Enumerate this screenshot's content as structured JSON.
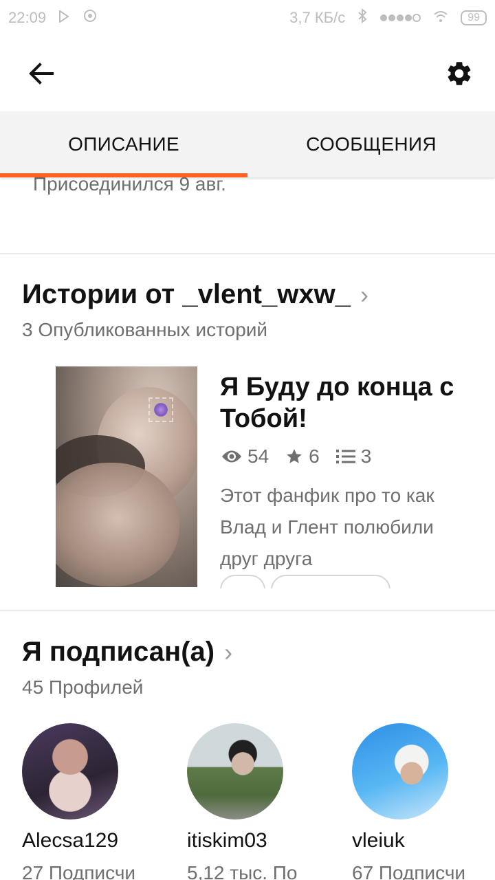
{
  "status_bar": {
    "time": "22:09",
    "network_speed": "3,7 КБ/с",
    "battery": "99"
  },
  "app_bar": {
    "back_icon": "arrow-left-icon",
    "settings_icon": "gear-icon"
  },
  "tabs": [
    {
      "label": "ОПИСАНИЕ",
      "active": true
    },
    {
      "label": "СООБЩЕНИЯ",
      "active": false
    }
  ],
  "about": {
    "joined": "Присоединился 9 авг."
  },
  "stories": {
    "title": "Истории от _vlent_wxw_",
    "subtitle": "3 Опубликованных историй",
    "items": [
      {
        "title": "Я Буду до конца с Тобой!",
        "views": "54",
        "votes": "6",
        "parts": "3",
        "description": "Этот фанфик про то как Влад и Глент полюбили друг друга"
      }
    ]
  },
  "following": {
    "title": "Я подписан(а)",
    "subtitle": "45 Профилей",
    "profiles": [
      {
        "name": "Alecsa129",
        "followers": "27 Подписчи"
      },
      {
        "name": "itiskim03",
        "followers": "5,12 тыс. По"
      },
      {
        "name": "vleiuk",
        "followers": "67 Подписчи"
      }
    ]
  },
  "colors": {
    "accent": "#ff6122",
    "tab_bg": "#f3f3f3",
    "secondary_text": "#6f6f6f"
  }
}
